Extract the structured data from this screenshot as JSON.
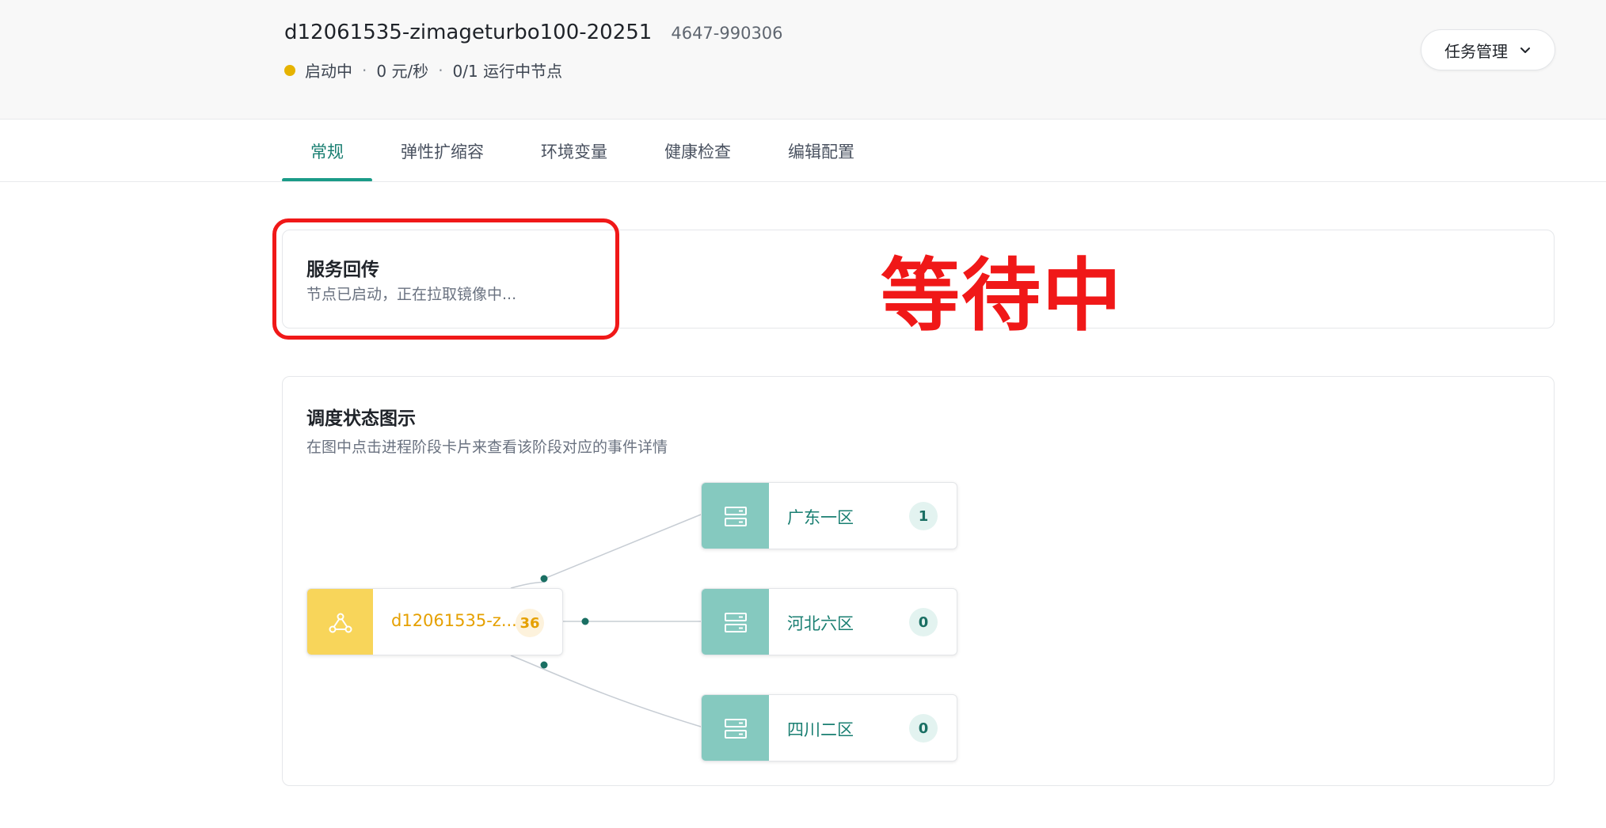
{
  "header": {
    "service_name": "d12061535-zimageturbo100-20251",
    "service_id": "4647-990306",
    "status": {
      "dot_color": "#e6b300",
      "state": "启动中",
      "rate": "0 元/秒",
      "nodes": "0/1 运行中节点"
    },
    "task_menu": {
      "label": "任务管理",
      "icon": "chevron-down-icon"
    }
  },
  "tabs": [
    {
      "label": "常规",
      "active": true
    },
    {
      "label": "弹性扩缩容",
      "active": false
    },
    {
      "label": "环境变量",
      "active": false
    },
    {
      "label": "健康检查",
      "active": false
    },
    {
      "label": "编辑配置",
      "active": false
    }
  ],
  "callback_card": {
    "title": "服务回传",
    "description": "节点已启动，正在拉取镜像中...",
    "annotation": "等待中",
    "annotation_color": "#f01818"
  },
  "schedule_card": {
    "title": "调度状态图示",
    "description": "在图中点击进程阶段卡片来查看该阶段对应的事件详情",
    "root": {
      "label": "d12061535-z...",
      "count": "36",
      "icon": "cluster-icon",
      "color": "#f8d55a"
    },
    "zones": [
      {
        "label": "广东一区",
        "count": "1",
        "icon": "server-icon"
      },
      {
        "label": "河北六区",
        "count": "0",
        "icon": "server-icon"
      },
      {
        "label": "四川二区",
        "count": "0",
        "icon": "server-icon"
      }
    ],
    "accent_color": "#85c9bf"
  }
}
